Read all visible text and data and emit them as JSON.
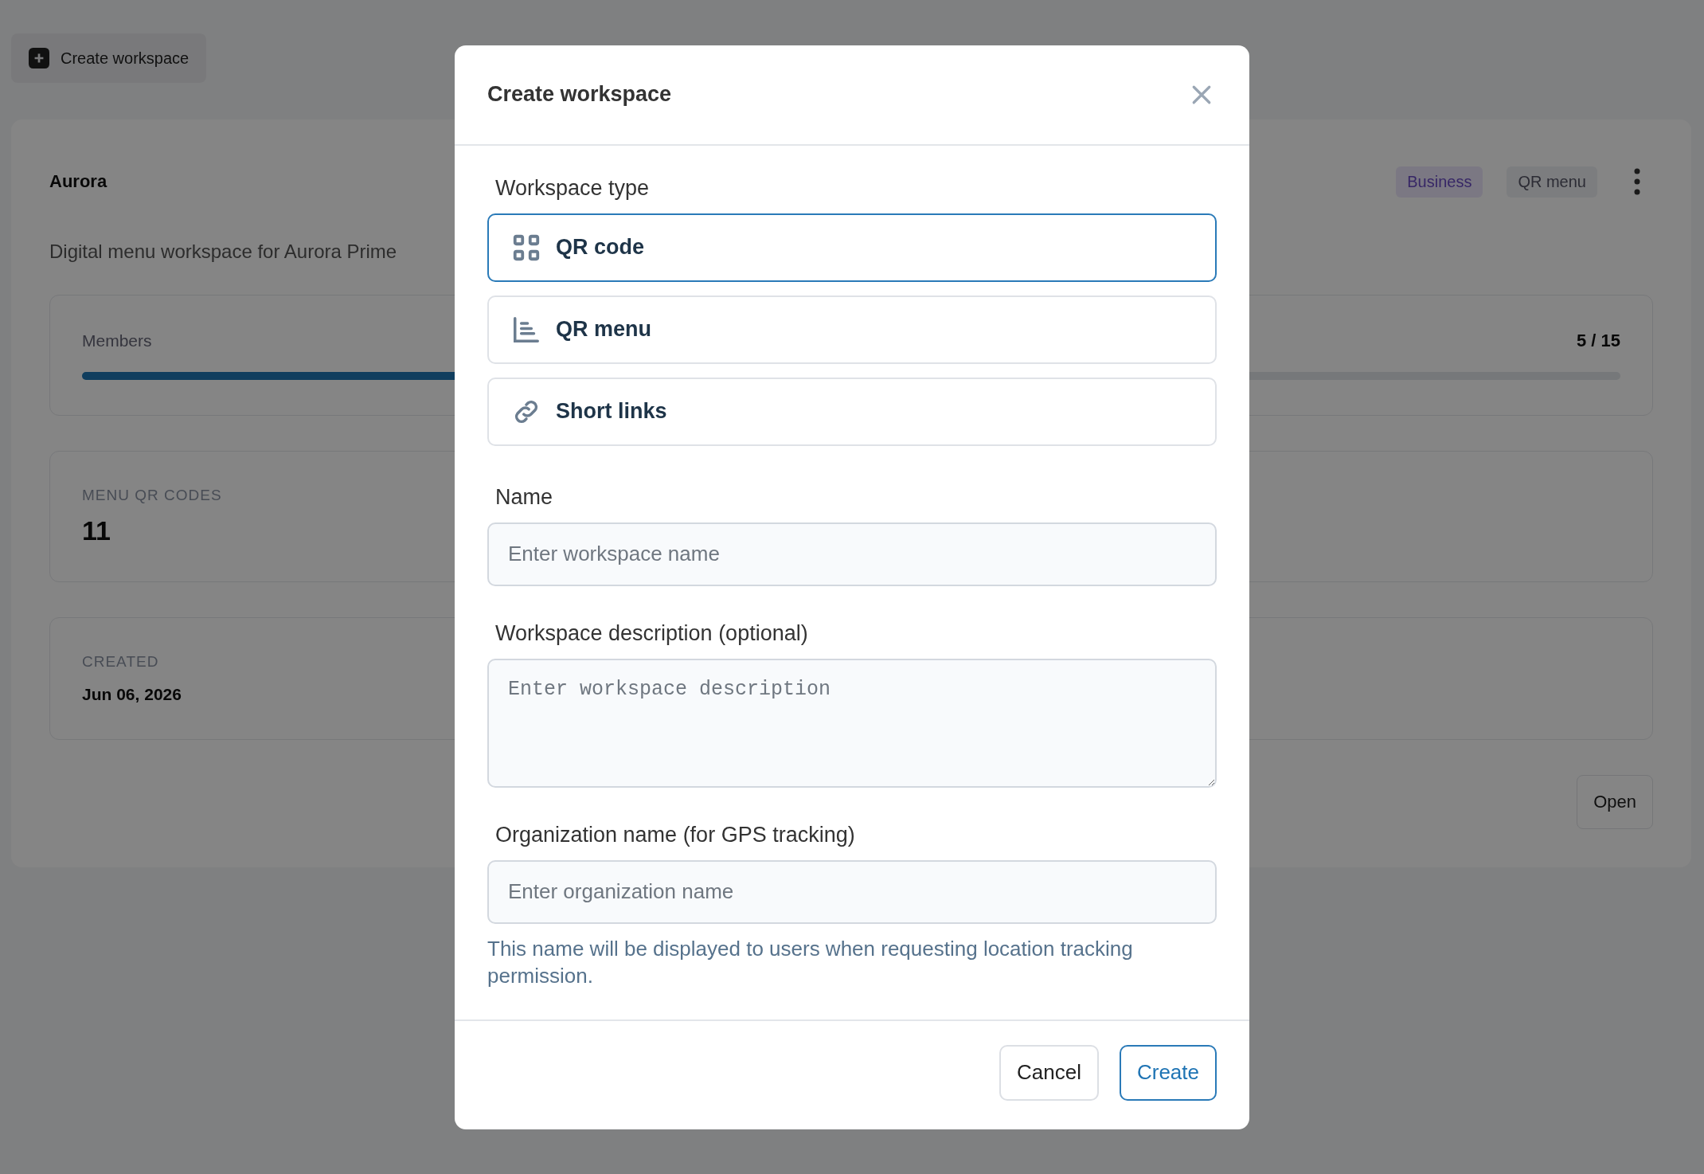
{
  "background": {
    "create_button": "Create workspace",
    "workspace": {
      "name": "Aurora",
      "description": "Digital menu workspace for Aurora Prime",
      "badges": [
        {
          "label": "Business",
          "kind": "plan"
        },
        {
          "label": "QR menu",
          "kind": "type"
        }
      ],
      "members": {
        "label": "Members",
        "reading": "5 / 15",
        "level": 0.33
      },
      "stats": [
        {
          "label": "MENU QR CODES",
          "value": "11",
          "kind": "big"
        },
        {
          "label": "CREATED",
          "value": "Jun 06, 2026",
          "kind": "small"
        }
      ],
      "open_button": "Open"
    }
  },
  "dialog": {
    "title": "Create workspace",
    "type_label": "Workspace type",
    "types": [
      {
        "label": "QR code",
        "selected": true
      },
      {
        "label": "QR menu",
        "selected": false
      },
      {
        "label": "Short links",
        "selected": false
      }
    ],
    "fields": [
      {
        "label": "Name",
        "placeholder": "Enter workspace name",
        "kind": "input"
      },
      {
        "label": "Workspace description (optional)",
        "placeholder": "Enter workspace description",
        "kind": "textarea"
      },
      {
        "label": "Organization name (for GPS tracking)",
        "placeholder": "Enter organization name",
        "kind": "input",
        "help": "This name will be displayed to users when requesting location tracking permission."
      }
    ],
    "buttons": [
      {
        "label": "Cancel",
        "kind": "secondary"
      },
      {
        "label": "Create",
        "kind": "primary"
      }
    ]
  }
}
